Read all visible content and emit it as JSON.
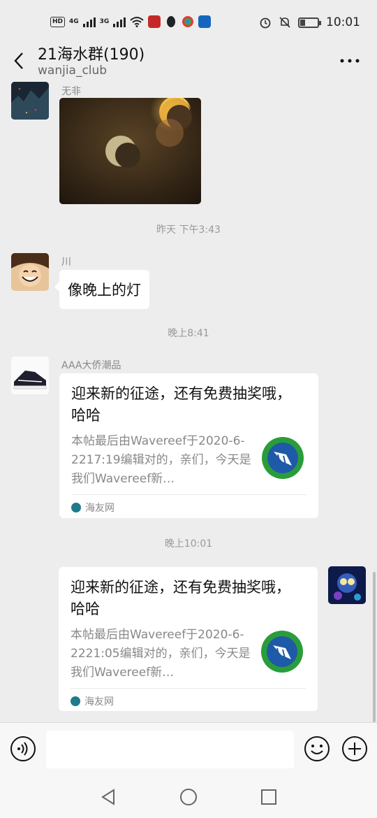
{
  "status_bar": {
    "network_hd": "HD",
    "network_1": "4G",
    "network_2": "3G",
    "time": "10:01"
  },
  "header": {
    "title": "21海水群(190)",
    "subtitle": "wanjia_club"
  },
  "messages": {
    "m1": {
      "sender": "无非",
      "type": "image"
    },
    "ts1": "昨天 下午3:43",
    "m2": {
      "sender": "川",
      "text": "像晚上的灯"
    },
    "ts2": "晚上8:41",
    "m3": {
      "sender": "AAA大侨潮品",
      "title": "迎来新的征途，还有免费抽奖哦，哈哈",
      "desc": "本帖最后由Wavereef于2020-6-2217:19编辑对的，亲们，今天是我们Wavereef新…",
      "source": "海友网"
    },
    "ts3": "晚上10:01",
    "m4": {
      "title": "迎来新的征途，还有免费抽奖哦，哈哈",
      "desc": "本帖最后由Wavereef于2020-6-2221:05编辑对的，亲们，今天是我们Wavereef新…",
      "source": "海友网"
    }
  },
  "input": {
    "value": "",
    "placeholder": ""
  },
  "colors": {
    "background": "#ededed",
    "bubble": "#ffffff",
    "accent_green": "#2a9d3a"
  }
}
